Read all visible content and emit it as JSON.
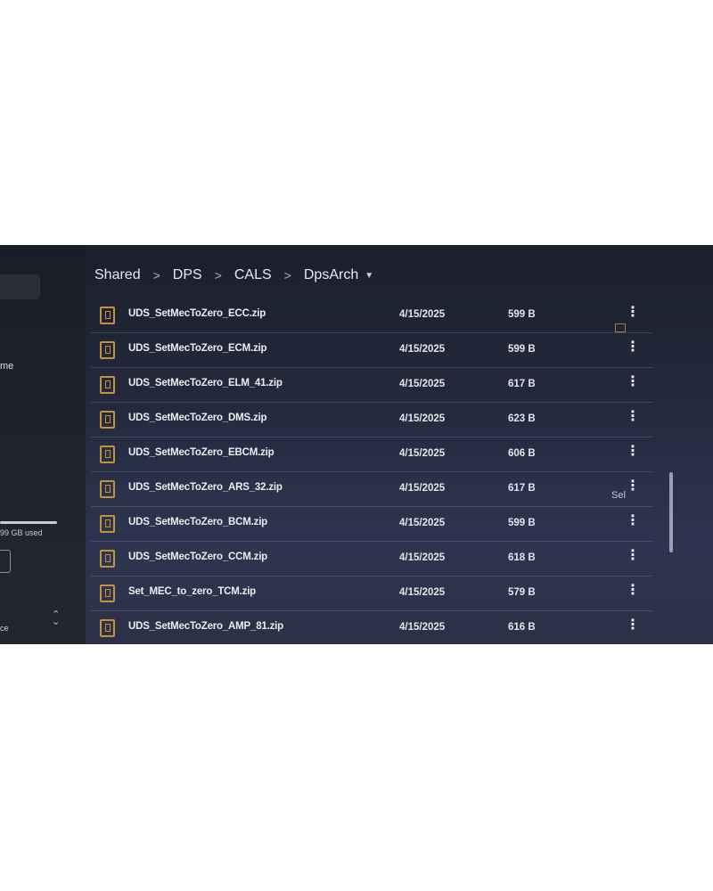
{
  "sidebar": {
    "shared_with_me_fragment": "me",
    "storage_text": "99 GB used",
    "bottom_fragment": "ce"
  },
  "breadcrumb": {
    "items": [
      "Shared",
      "DPS",
      "CALS",
      "DpsArch"
    ]
  },
  "files": [
    {
      "name": "UDS_SetMecToZero_ECC.zip",
      "date": "4/15/2025",
      "size": "599 B"
    },
    {
      "name": "UDS_SetMecToZero_ECM.zip",
      "date": "4/15/2025",
      "size": "599 B"
    },
    {
      "name": "UDS_SetMecToZero_ELM_41.zip",
      "date": "4/15/2025",
      "size": "617 B"
    },
    {
      "name": "UDS_SetMecToZero_DMS.zip",
      "date": "4/15/2025",
      "size": "623 B"
    },
    {
      "name": "UDS_SetMecToZero_EBCM.zip",
      "date": "4/15/2025",
      "size": "606 B"
    },
    {
      "name": "UDS_SetMecToZero_ARS_32.zip",
      "date": "4/15/2025",
      "size": "617 B"
    },
    {
      "name": "UDS_SetMecToZero_BCM.zip",
      "date": "4/15/2025",
      "size": "599 B"
    },
    {
      "name": "UDS_SetMecToZero_CCM.zip",
      "date": "4/15/2025",
      "size": "618 B"
    },
    {
      "name": "Set_MEC_to_zero_TCM.zip",
      "date": "4/15/2025",
      "size": "579 B"
    },
    {
      "name": "UDS_SetMecToZero_AMP_81.zip",
      "date": "4/15/2025",
      "size": "616 B"
    }
  ],
  "more_glyph": "⋮",
  "right_panel": {
    "text_fragment": "Sel"
  },
  "colors": {
    "zip_icon": "#c4913f",
    "background": "#242a3d"
  }
}
